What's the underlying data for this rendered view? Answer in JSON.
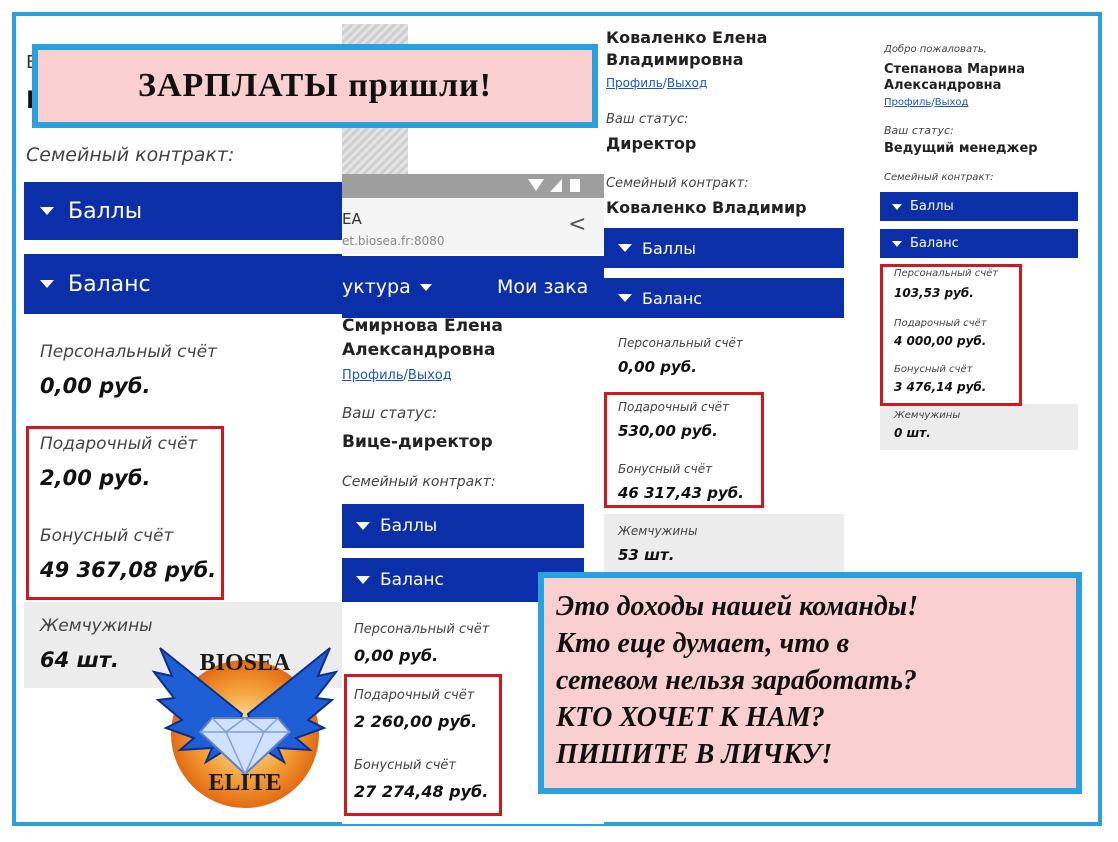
{
  "headline": "ЗАРПЛАТЫ пришли!",
  "message_lines": [
    "Это доходы нашей команды!",
    "Кто еще думает, что в",
    "сетевом нельзя заработать?",
    "КТО ХОЧЕТ К НАМ?",
    "ПИШИТЕ В ЛИЧКУ!"
  ],
  "logo": {
    "top": "BIOSEA",
    "bottom": "ELITE"
  },
  "colors": {
    "brand_blue": "#0a2fa8",
    "frame_blue": "#2aa0dc",
    "highlight_red": "#d0191e",
    "banner_pink": "#f9cfcf"
  },
  "panel1": {
    "partial_letter_a": "B",
    "partial_letter_b": "E",
    "family_label": "Семейный контракт:",
    "bar_points": "Баллы",
    "bar_balance": "Баланс",
    "personal_label": "Персональный счёт",
    "personal_value": "0,00 руб.",
    "gift_label": "Подарочный счёт",
    "gift_value": "2,00 руб.",
    "bonus_label": "Бонусный счёт",
    "bonus_value": "49 367,08 руб.",
    "pearls_label": "Жемчужины",
    "pearls_value": "64 шт."
  },
  "panel2": {
    "app_title": "EA",
    "url": "et.biosea.fr:8080",
    "nav_left": "уктура",
    "nav_right": "Мои зака",
    "name_line1": "Смирнова Елена",
    "name_line2": "Александровна",
    "profile": "Профиль",
    "sep": "/",
    "logout": "Выход",
    "status_label": "Ваш статус:",
    "status_value": "Вице-директор",
    "family_label": "Семейный контракт:",
    "bar_points": "Баллы",
    "bar_balance": "Баланс",
    "personal_label": "Персональный счёт",
    "personal_value": "0,00 руб.",
    "gift_label": "Подарочный счёт",
    "gift_value": "2 260,00 руб.",
    "bonus_label": "Бонусный счёт",
    "bonus_value": "27 274,48 руб."
  },
  "panel3": {
    "name_line1": "Коваленко Елена",
    "name_line2": "Владимировна",
    "profile": "Профиль",
    "sep": "/",
    "logout": "Выход",
    "status_label": "Ваш статус:",
    "status_value": "Директор",
    "family_label": "Семейный контракт:",
    "family_value": "Коваленко Владимир",
    "bar_points": "Баллы",
    "bar_balance": "Баланс",
    "personal_label": "Персональный счёт",
    "personal_value": "0,00 руб.",
    "gift_label": "Подарочный счёт",
    "gift_value": "530,00 руб.",
    "bonus_label": "Бонусный счёт",
    "bonus_value": "46 317,43 руб.",
    "pearls_label": "Жемчужины",
    "pearls_value": "53 шт."
  },
  "panel4": {
    "welcome": "Добро пожаловать,",
    "name_line1": "Степанова Марина",
    "name_line2": "Александровна",
    "profile": "Профиль",
    "sep": "/",
    "logout": "Выход",
    "status_label": "Ваш статус:",
    "status_value": "Ведущий менеджер",
    "family_label": "Семейный контракт:",
    "bar_points": "Баллы",
    "bar_balance": "Баланс",
    "personal_label": "Персональный счёт",
    "personal_value": "103,53 руб.",
    "gift_label": "Подарочный счёт",
    "gift_value": "4 000,00 руб.",
    "bonus_label": "Бонусный счёт",
    "bonus_value": "3 476,14 руб.",
    "pearls_label": "Жемчужины",
    "pearls_value": "0 шт."
  }
}
